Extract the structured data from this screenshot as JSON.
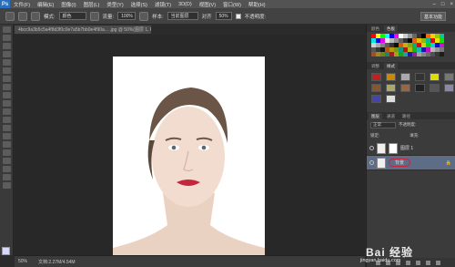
{
  "app": {
    "logo": "Ps",
    "menu": [
      "文件(F)",
      "编辑(E)",
      "图像(I)",
      "图层(L)",
      "类型(Y)",
      "选择(S)",
      "滤镜(T)",
      "3D(D)",
      "视图(V)",
      "窗口(W)",
      "帮助(H)"
    ],
    "window_controls": [
      "–",
      "□",
      "×"
    ]
  },
  "options": {
    "mode_label": "模式:",
    "mode_value": "颜色",
    "opacity_label": "不透明度:",
    "flow_label": "流量:",
    "flow_value": "100%",
    "smoothing_label": "对齐",
    "smoothing_value": "50%",
    "sample_label": "样本:",
    "sample_value": "当前图层",
    "workspace": "基本功能"
  },
  "document": {
    "tab_title": "4bcc9a3b5c5a4f8d3f0c0e7a5b7bb0e4f90a... .jpg @ 50%(图层 1, RGB/8)",
    "zoom": "50%",
    "doc_info": "文档:2.27M/4.54M"
  },
  "panels": {
    "color_tabs": [
      "颜色",
      "色板"
    ],
    "style_tabs": [
      "调整",
      "样式"
    ],
    "layer_tabs": [
      "图层",
      "通道",
      "路径"
    ],
    "blend_mode": "正常",
    "opacity_label": "不透明度:",
    "lock_label": "锁定:",
    "fill_label": "填充:",
    "layers": [
      {
        "name": "图层 1",
        "selected": false
      },
      {
        "name": "背景",
        "selected": true
      }
    ]
  },
  "watermark": {
    "title": "Bai 经验",
    "url": "jingyan.baidu.com"
  },
  "colors": {
    "accent": "#2a6fbb",
    "selected_layer": "#5d6d87",
    "lip_red": "#c4263b",
    "canvas_bg": "#282828"
  }
}
